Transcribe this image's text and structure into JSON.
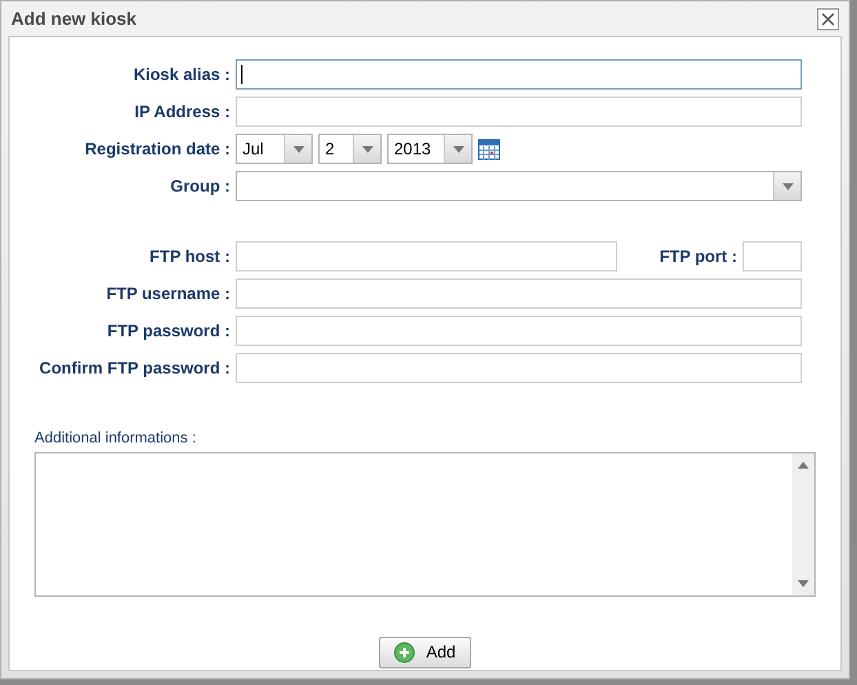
{
  "window": {
    "title": "Add new kiosk"
  },
  "fields": [
    {
      "kind": "text",
      "label": "Kiosk alias :",
      "focused": true
    },
    {
      "kind": "text",
      "label": "IP Address :",
      "focused": false
    },
    {
      "kind": "date",
      "label": "Registration date :",
      "month": "Jul",
      "day": "2",
      "year": "2013"
    },
    {
      "kind": "select",
      "label": "Group :"
    }
  ],
  "ftp_fields": [
    {
      "kind": "host_port",
      "label": "FTP host :",
      "port_label": "FTP port :"
    },
    {
      "kind": "text",
      "label": "FTP username :",
      "focused": false
    },
    {
      "kind": "text",
      "label": "FTP password :",
      "focused": false
    },
    {
      "kind": "text",
      "label": "Confirm FTP password :",
      "focused": false
    }
  ],
  "notes": {
    "label": "Additional informations :"
  },
  "buttons": [
    {
      "label": "Add"
    }
  ]
}
